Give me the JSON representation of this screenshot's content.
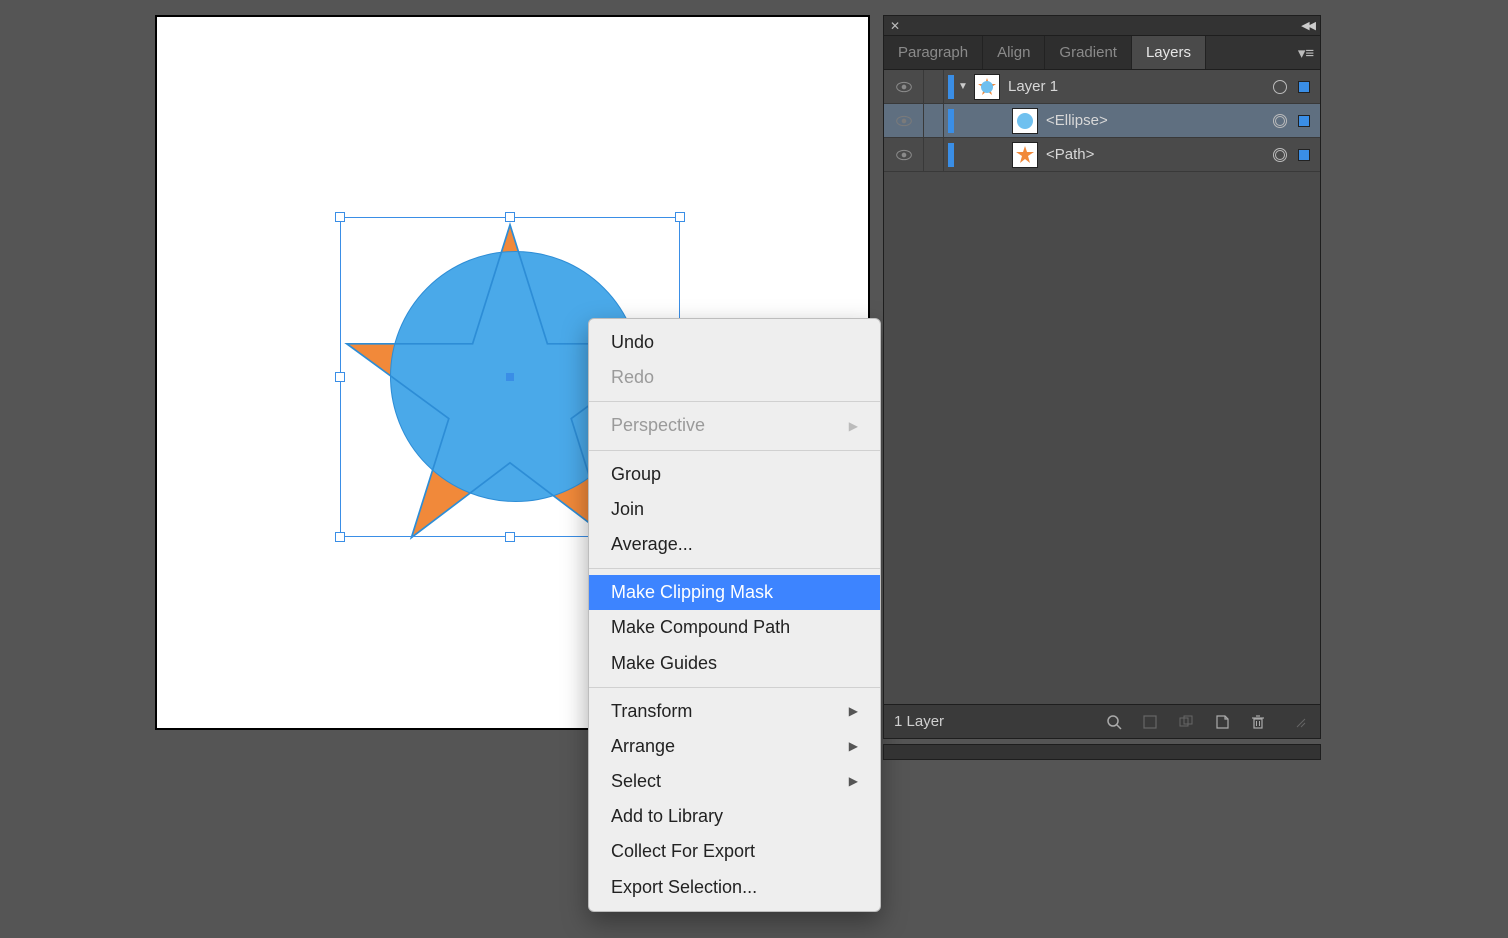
{
  "canvas": {
    "circle_fill": "#4aa9e9",
    "circle_stroke": "#2d8dd6",
    "star_fill": "#f1893a",
    "selection_color": "#3a8ee6"
  },
  "context_menu": {
    "items": [
      {
        "label": "Undo",
        "disabled": false
      },
      {
        "label": "Redo",
        "disabled": true
      }
    ],
    "perspective": "Perspective",
    "group_items": [
      {
        "label": "Group"
      },
      {
        "label": "Join"
      },
      {
        "label": "Average..."
      }
    ],
    "mask_items": [
      {
        "label": "Make Clipping Mask",
        "highlight": true
      },
      {
        "label": "Make Compound Path"
      },
      {
        "label": "Make Guides"
      }
    ],
    "transform_items": [
      {
        "label": "Transform",
        "arrow": true
      },
      {
        "label": "Arrange",
        "arrow": true
      },
      {
        "label": "Select",
        "arrow": true
      },
      {
        "label": "Add to Library"
      },
      {
        "label": "Collect For Export"
      },
      {
        "label": "Export Selection..."
      }
    ]
  },
  "panel": {
    "tabs": [
      "Paragraph",
      "Align",
      "Gradient",
      "Layers"
    ],
    "active_tab": "Layers",
    "layers": [
      {
        "name": "Layer 1",
        "indent": 0,
        "selected": false,
        "disclosure": true,
        "target": "single",
        "thumb": "layer"
      },
      {
        "name": "<Ellipse>",
        "indent": 1,
        "selected": true,
        "disclosure": false,
        "target": "double",
        "thumb": "ellipse"
      },
      {
        "name": "<Path>",
        "indent": 1,
        "selected": false,
        "disclosure": false,
        "target": "double",
        "thumb": "star"
      }
    ],
    "footer_count": "1 Layer"
  }
}
